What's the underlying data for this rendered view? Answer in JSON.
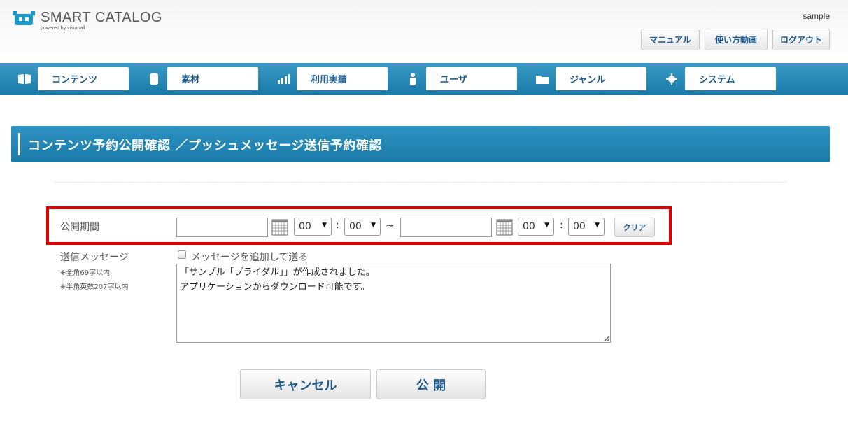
{
  "header": {
    "logo_title": "SMART CATALOG",
    "logo_sub": "powered by visumall",
    "user": "sample",
    "buttons": {
      "manual": "マニュアル",
      "howto_video": "使い方動画",
      "logout": "ログアウト"
    }
  },
  "nav": {
    "items": [
      {
        "label": "コンテンツ",
        "icon": "book-icon"
      },
      {
        "label": "素材",
        "icon": "database-icon"
      },
      {
        "label": "利用実績",
        "icon": "bar-chart-icon"
      },
      {
        "label": "ユーザ",
        "icon": "user-icon"
      },
      {
        "label": "ジャンル",
        "icon": "folder-icon"
      },
      {
        "label": "システム",
        "icon": "gear-icon"
      }
    ]
  },
  "section": {
    "title": "コンテンツ予約公開確認 ／プッシュメッセージ送信予約確認"
  },
  "form": {
    "period_label": "公開期間",
    "start_date": "",
    "start_hour": "00",
    "start_minute": "00",
    "range_separator": "~",
    "end_date": "",
    "end_hour": "00",
    "end_minute": "00",
    "time_separator": ":",
    "clear_label": "クリア",
    "message_label": "送信メッセージ",
    "note_full_width": "※全角69字以内",
    "note_half_width": "※半角英数207字以内",
    "add_message_checkbox_label": "メッセージを追加して送る",
    "add_message_checked": false,
    "message_lines": [
      "「サンプル「ブライダル」」が作成されました。",
      "アプリケーションからダウンロード可能です。"
    ]
  },
  "actions": {
    "cancel_label": "キャンセル",
    "publish_label": "公 開"
  },
  "colors": {
    "nav_blue": "#1a7aa8",
    "link_text": "#1d5a8c",
    "highlight_red": "#e00000"
  }
}
